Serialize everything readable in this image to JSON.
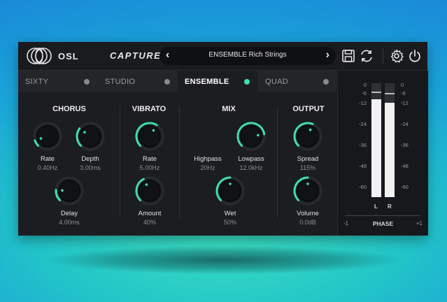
{
  "header": {
    "brand": "OSL",
    "product": "CAPTURE",
    "preset_name": "ENSEMBLE Rich Strings",
    "prev": "‹",
    "next": "›"
  },
  "tabs": [
    {
      "label": "SIXTY",
      "active": false
    },
    {
      "label": "STUDIO",
      "active": false
    },
    {
      "label": "ENSEMBLE",
      "active": true
    },
    {
      "label": "QUAD",
      "active": false
    }
  ],
  "sections": {
    "chorus": "CHORUS",
    "vibrato": "VIBRATO",
    "mix": "MIX",
    "output": "OUTPUT"
  },
  "knobs": {
    "chorus_rate": {
      "label": "Rate",
      "value": "0.40Hz",
      "level": 0.1
    },
    "chorus_depth": {
      "label": "Depth",
      "value": "3.00ms",
      "level": 0.3
    },
    "chorus_delay": {
      "label": "Delay",
      "value": "4.00ms",
      "level": 0.18
    },
    "vibrato_rate": {
      "label": "Rate",
      "value": "5.00Hz",
      "level": 0.62
    },
    "vibrato_amount": {
      "label": "Amount",
      "value": "40%",
      "level": 0.4
    },
    "highpass": {
      "label": "Highpass",
      "value": "20Hz",
      "level": 0.0
    },
    "lowpass": {
      "label": "Lowpass",
      "value": "12.0kHz",
      "level": 0.8
    },
    "wet": {
      "label": "Wet",
      "value": "50%",
      "level": 0.5
    },
    "spread": {
      "label": "Spread",
      "value": "115%",
      "level": 0.58
    },
    "volume": {
      "label": "Volume",
      "value": "0.0dB",
      "level": 0.5
    }
  },
  "meters": {
    "scale": [
      "0",
      "-6",
      "-12",
      "-24",
      "-36",
      "-48",
      "-60"
    ],
    "left_label": "L",
    "right_label": "R",
    "left_level": 0.86,
    "right_level": 0.83,
    "phase_title": "PHASE",
    "phase_min": "-1",
    "phase_max": "+1"
  },
  "colors": {
    "accent": "#3fe0a8",
    "panel": "#1c1d20"
  }
}
